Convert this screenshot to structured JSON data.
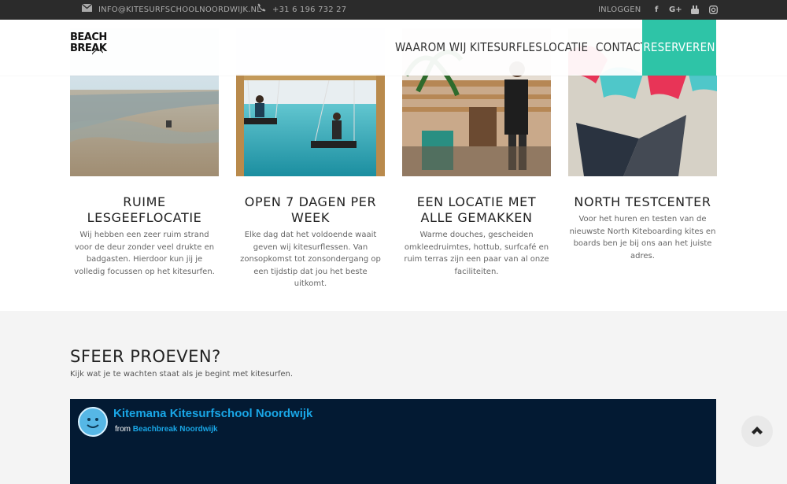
{
  "topbar": {
    "email": "INFO@KITESURFSCHOOLNOORDWIJK.NL",
    "phone": "+31 6 196 732 27",
    "login": "INLOGGEN",
    "social": [
      "facebook-icon",
      "google-plus-icon",
      "youtube-icon",
      "instagram-icon"
    ]
  },
  "header": {
    "logo_line1": "BEACH",
    "logo_line2": "BREAK",
    "nav": [
      "WAAROM WIJ",
      "KITESURFLES",
      "LOCATIE",
      "CONTACT",
      "RESERVEREN"
    ],
    "accent": "#2ec4a7"
  },
  "features": [
    {
      "title": "RUIME LESGEEFLOCATIE",
      "text": "Wij hebben een zeer ruim strand voor de deur zonder veel drukte en badgasten. Hierdoor kun jij je volledig focussen op het kitesurfen."
    },
    {
      "title": "OPEN 7 DAGEN PER WEEK",
      "text": "Elke dag dat het voldoende waait geven wij kitesurflessen. Van zonsopkomst tot zonsondergang op een tijdstip dat jou het beste uitkomt."
    },
    {
      "title": "EEN LOCATIE MET ALLE GEMAKKEN",
      "text": "Warme douches, gescheiden omkleedruimtes, hottub, surfcafé en ruim terras zijn een paar van al onze faciliteiten."
    },
    {
      "title": "NORTH TESTCENTER",
      "text": "Voor het huren en testen van de nieuwste North Kiteboarding kites en boards ben je bij ons aan het juiste adres."
    }
  ],
  "sfeer": {
    "title": "SFEER PROEVEN?",
    "subtitle": "Kijk wat je te wachten staat als je begint met kitesurfen.",
    "video_title": "Kitemana Kitesurfschool Noordwijk",
    "video_from_label": "from",
    "video_from_channel": "Beachbreak Noordwijk"
  }
}
